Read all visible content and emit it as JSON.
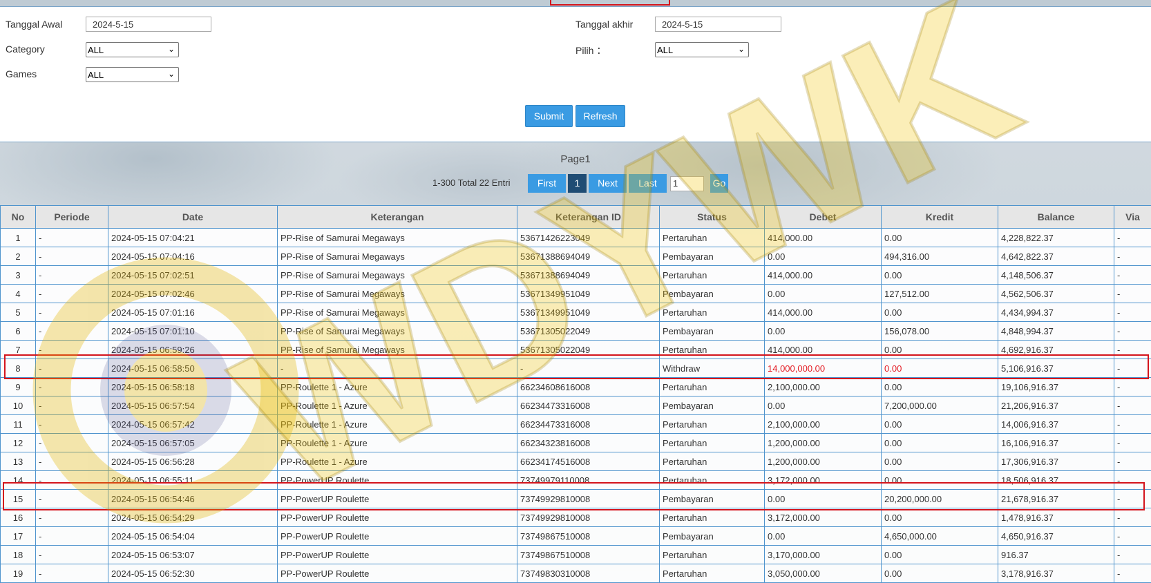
{
  "filters": {
    "start_date_label": "Tanggal Awal",
    "start_date_value": "2024-5-15",
    "end_date_label": "Tanggal akhir",
    "end_date_value": "2024-5-15",
    "category_label": "Category",
    "category_value": "ALL",
    "pilih_label": "Pilih ：",
    "pilih_value": "ALL",
    "games_label": "Games",
    "games_value": "ALL",
    "submit_label": "Submit",
    "refresh_label": "Refresh"
  },
  "pager": {
    "title": "Page1",
    "info": "1-300 Total 22 Entri",
    "first_label": "First",
    "current_page": "1",
    "next_label": "Next",
    "last_label": "Last",
    "goto_value": "1",
    "go_label": "Go"
  },
  "table": {
    "headers": [
      "No",
      "Periode",
      "Date",
      "Keterangan",
      "Keterangan ID",
      "Status",
      "Debet",
      "Kredit",
      "Balance",
      "Via"
    ],
    "rows": [
      [
        "1",
        "-",
        "2024-05-15 07:04:21",
        "PP-Rise of Samurai Megaways",
        "53671426223049",
        "Pertaruhan",
        "414,000.00",
        "0.00",
        "4,228,822.37",
        "-"
      ],
      [
        "2",
        "-",
        "2024-05-15 07:04:16",
        "PP-Rise of Samurai Megaways",
        "53671388694049",
        "Pembayaran",
        "0.00",
        "494,316.00",
        "4,642,822.37",
        "-"
      ],
      [
        "3",
        "-",
        "2024-05-15 07:02:51",
        "PP-Rise of Samurai Megaways",
        "53671388694049",
        "Pertaruhan",
        "414,000.00",
        "0.00",
        "4,148,506.37",
        "-"
      ],
      [
        "4",
        "-",
        "2024-05-15 07:02:46",
        "PP-Rise of Samurai Megaways",
        "53671349951049",
        "Pembayaran",
        "0.00",
        "127,512.00",
        "4,562,506.37",
        "-"
      ],
      [
        "5",
        "-",
        "2024-05-15 07:01:16",
        "PP-Rise of Samurai Megaways",
        "53671349951049",
        "Pertaruhan",
        "414,000.00",
        "0.00",
        "4,434,994.37",
        "-"
      ],
      [
        "6",
        "-",
        "2024-05-15 07:01:10",
        "PP-Rise of Samurai Megaways",
        "53671305022049",
        "Pembayaran",
        "0.00",
        "156,078.00",
        "4,848,994.37",
        "-"
      ],
      [
        "7",
        "-",
        "2024-05-15 06:59:26",
        "PP-Rise of Samurai Megaways",
        "53671305022049",
        "Pertaruhan",
        "414,000.00",
        "0.00",
        "4,692,916.37",
        "-"
      ],
      [
        "8",
        "-",
        "2024-05-15 06:58:50",
        "-",
        "-",
        "Withdraw",
        "14,000,000.00",
        "0.00",
        "5,106,916.37",
        "-"
      ],
      [
        "9",
        "-",
        "2024-05-15 06:58:18",
        "PP-Roulette 1 - Azure",
        "66234608616008",
        "Pertaruhan",
        "2,100,000.00",
        "0.00",
        "19,106,916.37",
        "-"
      ],
      [
        "10",
        "-",
        "2024-05-15 06:57:54",
        "PP-Roulette 1 - Azure",
        "66234473316008",
        "Pembayaran",
        "0.00",
        "7,200,000.00",
        "21,206,916.37",
        "-"
      ],
      [
        "11",
        "-",
        "2024-05-15 06:57:42",
        "PP-Roulette 1 - Azure",
        "66234473316008",
        "Pertaruhan",
        "2,100,000.00",
        "0.00",
        "14,006,916.37",
        "-"
      ],
      [
        "12",
        "-",
        "2024-05-15 06:57:05",
        "PP-Roulette 1 - Azure",
        "66234323816008",
        "Pertaruhan",
        "1,200,000.00",
        "0.00",
        "16,106,916.37",
        "-"
      ],
      [
        "13",
        "-",
        "2024-05-15 06:56:28",
        "PP-Roulette 1 - Azure",
        "66234174516008",
        "Pertaruhan",
        "1,200,000.00",
        "0.00",
        "17,306,916.37",
        "-"
      ],
      [
        "14",
        "-",
        "2024-05-15 06:55:11",
        "PP-PowerUP Roulette",
        "73749979110008",
        "Pertaruhan",
        "3,172,000.00",
        "0.00",
        "18,506,916.37",
        "-"
      ],
      [
        "15",
        "-",
        "2024-05-15 06:54:46",
        "PP-PowerUP Roulette",
        "73749929810008",
        "Pembayaran",
        "0.00",
        "20,200,000.00",
        "21,678,916.37",
        "-"
      ],
      [
        "16",
        "-",
        "2024-05-15 06:54:29",
        "PP-PowerUP Roulette",
        "73749929810008",
        "Pertaruhan",
        "3,172,000.00",
        "0.00",
        "1,478,916.37",
        "-"
      ],
      [
        "17",
        "-",
        "2024-05-15 06:54:04",
        "PP-PowerUP Roulette",
        "73749867510008",
        "Pembayaran",
        "0.00",
        "4,650,000.00",
        "4,650,916.37",
        "-"
      ],
      [
        "18",
        "-",
        "2024-05-15 06:53:07",
        "PP-PowerUP Roulette",
        "73749867510008",
        "Pertaruhan",
        "3,170,000.00",
        "0.00",
        "916.37",
        "-"
      ],
      [
        "19",
        "-",
        "2024-05-15 06:52:30",
        "PP-PowerUP Roulette",
        "73749830310008",
        "Pertaruhan",
        "3,050,000.00",
        "0.00",
        "3,178,916.37",
        "-"
      ]
    ],
    "red_text_row": "8",
    "highlighted_rows": [
      "8",
      "15"
    ]
  },
  "colors": {
    "button_blue": "#3a9be3",
    "active_page": "#1f4c74",
    "border_blue": "#4f94cd",
    "highlight_red": "#d4141c",
    "withdraw_text_red": "#e31b23"
  },
  "watermark": {
    "text": "WDYWK",
    "icon": "gold-coin-logo-icon"
  }
}
